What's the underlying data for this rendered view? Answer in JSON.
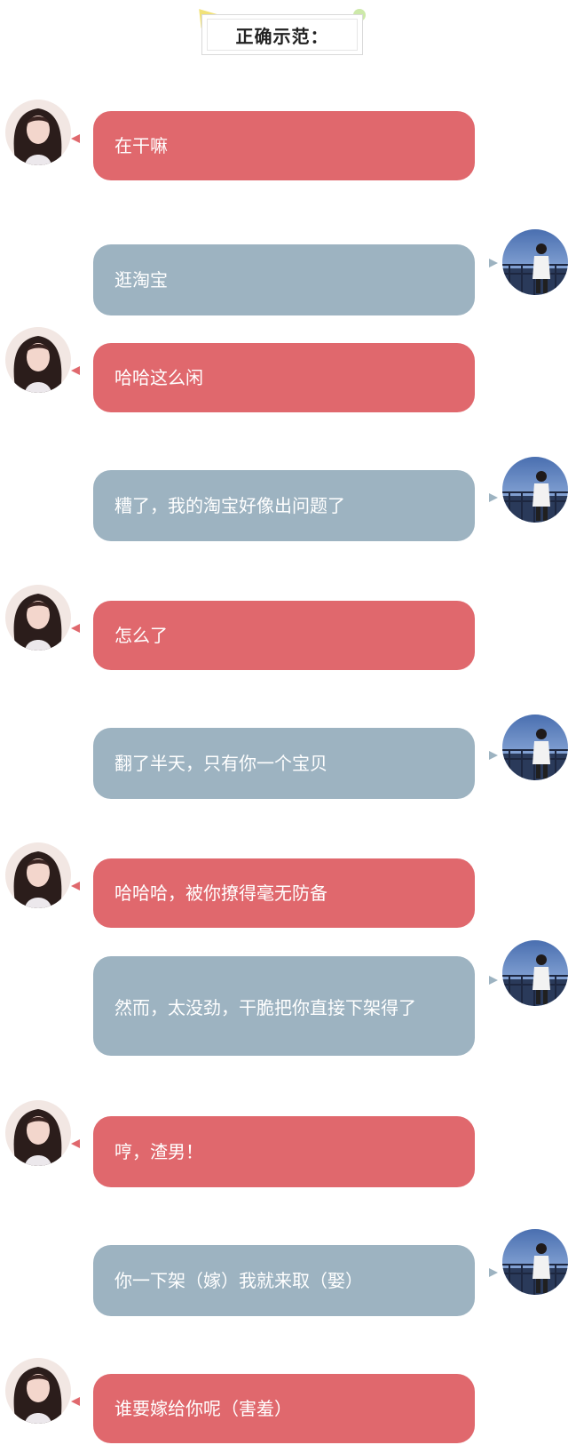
{
  "header": {
    "title": "正确示范："
  },
  "colors": {
    "girl_bubble": "#e0686d",
    "boy_bubble": "#9db3c1",
    "title_triangle": "#f1e27a",
    "title_dot": "#cde9a9"
  },
  "messages": [
    {
      "sender": "girl",
      "text": "在干嘛"
    },
    {
      "sender": "boy",
      "text": "逛淘宝"
    },
    {
      "sender": "girl",
      "text": "哈哈这么闲"
    },
    {
      "sender": "boy",
      "text": "糟了，我的淘宝好像出问题了"
    },
    {
      "sender": "girl",
      "text": "怎么了"
    },
    {
      "sender": "boy",
      "text": "翻了半天，只有你一个宝贝"
    },
    {
      "sender": "girl",
      "text": "哈哈哈，被你撩得毫无防备"
    },
    {
      "sender": "boy",
      "text": "然而，太没劲，干脆把你直接下架得了"
    },
    {
      "sender": "girl",
      "text": "哼，渣男！"
    },
    {
      "sender": "boy",
      "text": "你一下架（嫁）我就来取（娶）"
    },
    {
      "sender": "girl",
      "text": "谁要嫁给你呢（害羞）"
    }
  ]
}
